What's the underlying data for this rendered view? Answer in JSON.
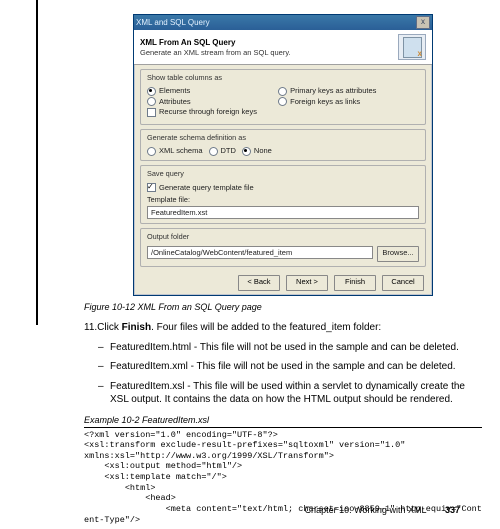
{
  "dialog": {
    "titlebar": "XML and SQL Query",
    "heading": "XML From An SQL Query",
    "subheading": "Generate an XML stream from an SQL query.",
    "group1": {
      "legend": "Show table columns as",
      "opts": [
        "Elements",
        "Attributes",
        "Primary keys as attributes",
        "Foreign keys as links"
      ],
      "recurse": "Recurse through foreign keys"
    },
    "group2": {
      "legend": "Generate schema definition as",
      "opts": [
        "XML schema",
        "DTD",
        "None"
      ]
    },
    "group3": {
      "legend": "Save query",
      "check": "Generate query template file",
      "tflabel": "Template file:",
      "tfvalue": "FeaturedItem.xst"
    },
    "group4": {
      "legend": "Output folder",
      "path": "/OnlineCatalog/WebContent/featured_item",
      "browse": "Browse..."
    },
    "buttons": [
      "< Back",
      "Next >",
      "Finish",
      "Cancel"
    ]
  },
  "figure_caption": "Figure 10-12   XML From an SQL Query page",
  "step": {
    "prefix": "11.Click ",
    "bold": "Finish",
    "suffix": ". Four files will be added to the featured_item folder:"
  },
  "bullets": [
    "FeaturedItem.html - This file will not be used in the sample and can be deleted.",
    "FeaturedItem.xml - This file will not be used in the sample and can be deleted.",
    "FeaturedItem.xsl - This file will be used within a servlet to dynamically create the XSL output. It contains the data on how the HTML output should be rendered."
  ],
  "example_caption": "Example 10-2   FeaturedItem.xsl",
  "code": "<?xml version=\"1.0\" encoding=\"UTF-8\"?>\n<xsl:transform exclude-result-prefixes=\"sqltoxml\" version=\"1.0\"\nxmlns:xsl=\"http://www.w3.org/1999/XSL/Transform\">\n    <xsl:output method=\"html\"/>\n    <xsl:template match=\"/\">\n        <html>\n            <head>\n                <meta content=\"text/html; charset=iso-8859-1\" http-equiv=\"Content-Type\"/>",
  "footer": {
    "chapter": "Chapter 10. Working with XML",
    "page": "337"
  }
}
